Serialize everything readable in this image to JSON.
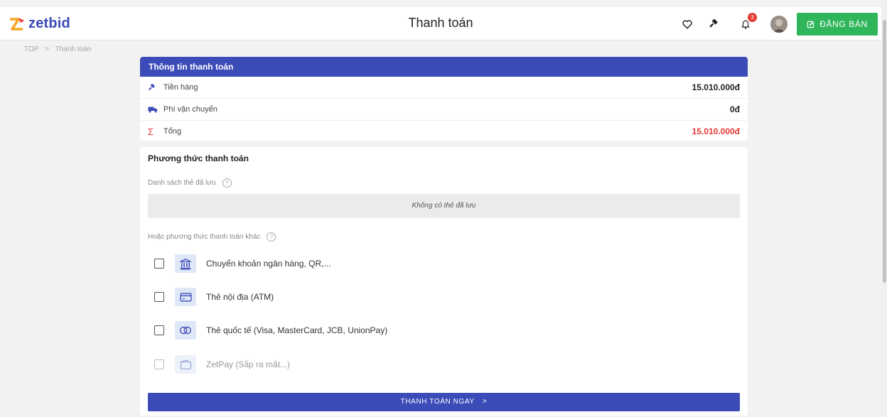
{
  "header": {
    "logo_text": "zetbid",
    "title": "Thanh toán",
    "notification_count": "3",
    "sell_button": "ĐĂNG BÁN",
    "icons": [
      "heart-icon",
      "gavel-icon",
      "bell-icon",
      "avatar",
      "edit-icon"
    ]
  },
  "breadcrumb": {
    "root": "TOP",
    "separator": ">",
    "current": "Thanh toán"
  },
  "summary": {
    "heading": "Thông tin thanh toán",
    "rows": [
      {
        "label": "Tiền hàng",
        "value": "15.010.000đ",
        "icon": "gavel-icon"
      },
      {
        "label": "Phí vận chuyển",
        "value": "0đ",
        "icon": "truck-icon"
      },
      {
        "label": "Tổng",
        "value": "15.010.000đ",
        "icon": "sigma-icon"
      }
    ]
  },
  "payment": {
    "title": "Phương thức thanh toán",
    "saved_label": "Danh sách thẻ đã lưu",
    "no_saved": "Không có thẻ đã lưu",
    "other_label": "Hoặc phương thức thanh toán khác",
    "options": [
      {
        "label": "Chuyển khoản ngân hàng, QR,...",
        "icon": "bank-icon",
        "enabled": true
      },
      {
        "label": "Thẻ nội địa (ATM)",
        "icon": "card-icon",
        "enabled": true
      },
      {
        "label": "Thẻ quốc tế (Visa, MasterCard, JCB, UnionPay)",
        "icon": "mastercard-icon",
        "enabled": true
      },
      {
        "label": "ZetPay (Sắp ra mắt...)",
        "icon": "wallet-icon",
        "enabled": false
      }
    ],
    "pay_button": "THANH TOÁN NGAY",
    "pay_button_arrow": ">"
  },
  "colors": {
    "primary": "#3b4bb8",
    "success": "#2fb55a",
    "danger": "#e53935",
    "logo_accent": "#f5a623"
  }
}
